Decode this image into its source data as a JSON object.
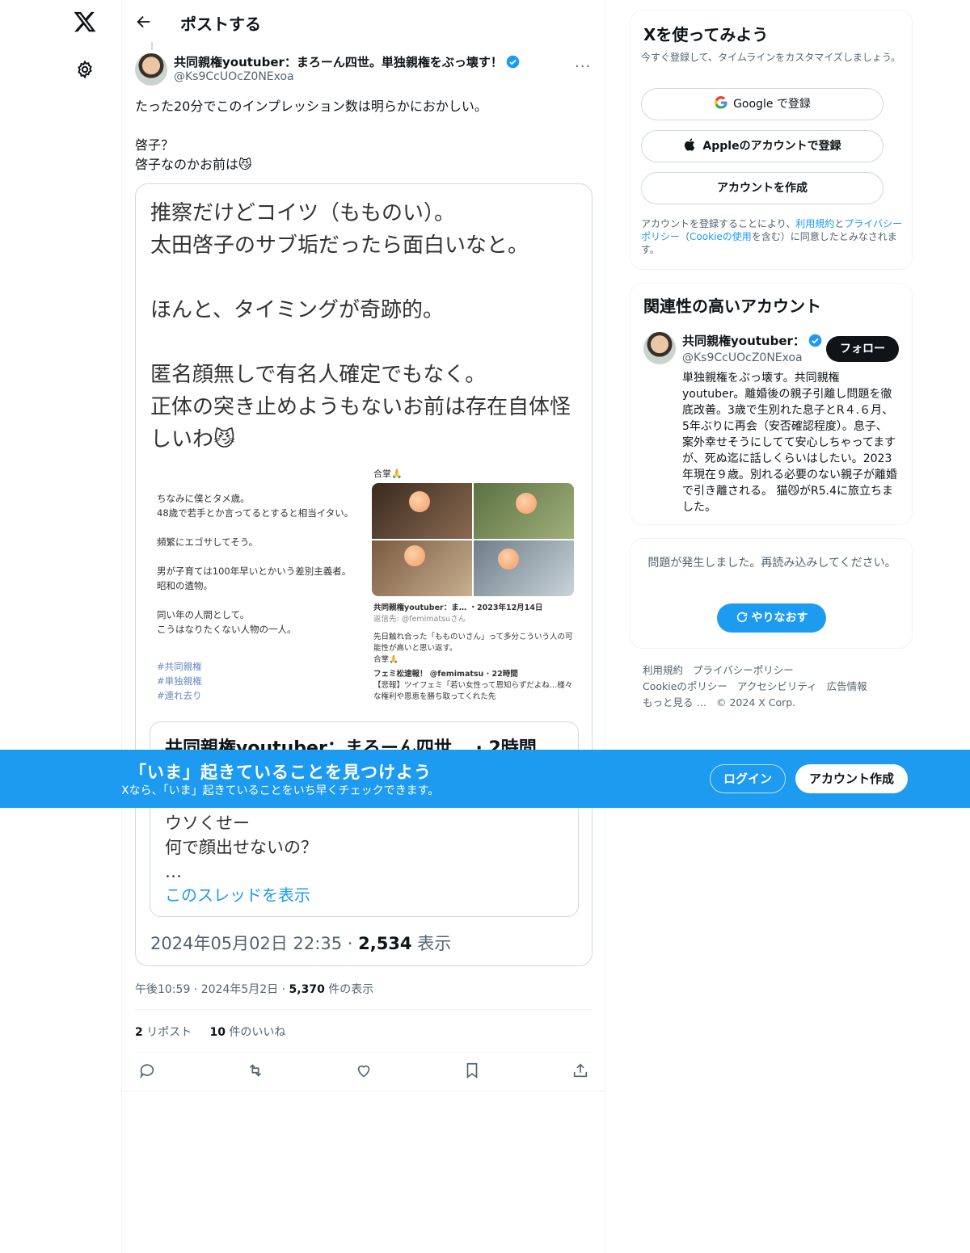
{
  "header": {
    "title": "ポストする"
  },
  "post": {
    "author_name": "共同親権youtuber：まろーん四世。単独親権をぶっ壊す！",
    "author_handle": "@Ks9CcUOcZ0NExoa",
    "more_label": "···",
    "text": "たった20分でこのインプレッション数は明らかにおかしい。\n\n啓子？\n啓子なのかお前は😼",
    "card": {
      "big_text": "推察だけどコイツ（もものい）。\n太田啓子のサブ垢だったら面白いなと。\n\nほんと、タイミングが奇跡的。\n\n匿名顔無しで有名人確定でもなく。\n正体の突き止めようもないお前は存在自体怪しいわ😼",
      "left_text": "ちなみに僕とタメ歳。\n48歳で若手とか言ってるとすると相当イタい。\n\n頻繁にエゴサしてそう。\n\n男が子育ては100年早いとかいう差別主義者。\n昭和の遺物。\n\n同い年の人間として。\nこうはなりたくない人物の一人。",
      "left_tags": "#共同親権\n#単独親権\n#連れ去り",
      "right_top": "合掌🙏",
      "mini_head": "共同親権youtuber：ま… ・2023年12月14日",
      "mini_reply": "返信先: @femimatsuさん",
      "mini_body": "先日触れ合った「もものいさん」って多分こういう人の可能性が高いと思い返す。\n合掌🙏",
      "mini_inner": "フェミ松速報！ @femimatsu · 22時間",
      "mini_inner_body": "【悲報】ツイフェミ「若い女性って恩知らずだよね…様々な権利や恩恵を勝ち取ってくれた先",
      "quote_head": "共同親権youtuber：まろーん四世… · 2時間",
      "quote_body": "ウソくせー\n何で顔出せないの？\n…",
      "quote_link": "このスレッドを表示",
      "meta_time": "2024年05月02日 22:35 · ",
      "meta_views": "2,534",
      "meta_views_label": " 表示"
    },
    "time": "午後10:59",
    "date": "2024年5月2日",
    "views": "5,370",
    "views_label": "件の表示",
    "reposts": "2",
    "reposts_label": "リポスト",
    "likes": "10",
    "likes_label": "件のいいね"
  },
  "signup": {
    "title": "Xを使ってみよう",
    "subtitle": "今すぐ登録して、タイムラインをカスタマイズしましょう。",
    "google": "Google で登録",
    "apple": "Appleのアカウントで登録",
    "create": "アカウントを作成",
    "legal_1": "アカウントを登録することにより、",
    "terms": "利用規約",
    "and": "と",
    "privacy": "プライバシーポリシー",
    "paren_open": "（",
    "cookie": "Cookieの使用",
    "legal_2": "を含む）に同意したとみなされます。"
  },
  "related": {
    "title": "関連性の高いアカウント",
    "name": "共同親権youtuber：",
    "handle": "@Ks9CcUOcZ0NExoa",
    "follow": "フォロー",
    "bio": "単独親権をぶっ壊す。共同親権youtuber。離婚後の親子引離し問題を徹底改善。3歳で生別れた息子とR４.６月、5年ぶりに再会（安否確認程度）。息子、案外幸せそうにしてて安心しちゃってますが、死ぬ迄に話しくらいはしたい。2023年現在９歳。別れる必要のない親子が離婚で引き離される。 猫😼がR5.4に旅立ちました。"
  },
  "error": {
    "text": "問題が発生しました。再読み込みしてください。",
    "retry": "やりなおす"
  },
  "footer": {
    "links": [
      "利用規約",
      "プライバシーポリシー",
      "Cookieのポリシー",
      "アクセシビリティ",
      "広告情報",
      "もっと見る …"
    ],
    "copyright": "© 2024 X Corp."
  },
  "banner": {
    "headline": "「いま」起きていることを見つけよう",
    "sub": "Xなら、「いま」起きていることをいち早くチェックできます。",
    "login": "ログイン",
    "signup": "アカウント作成"
  },
  "colors": {
    "accent": "#1d9bf0",
    "text": "#0f1419",
    "muted": "#536471"
  },
  "icons": [
    "x-logo-icon",
    "gear-icon",
    "back-arrow-icon",
    "verified-icon",
    "reply-icon",
    "repost-icon",
    "like-icon",
    "bookmark-icon",
    "share-icon",
    "google-icon",
    "apple-icon",
    "refresh-icon"
  ]
}
